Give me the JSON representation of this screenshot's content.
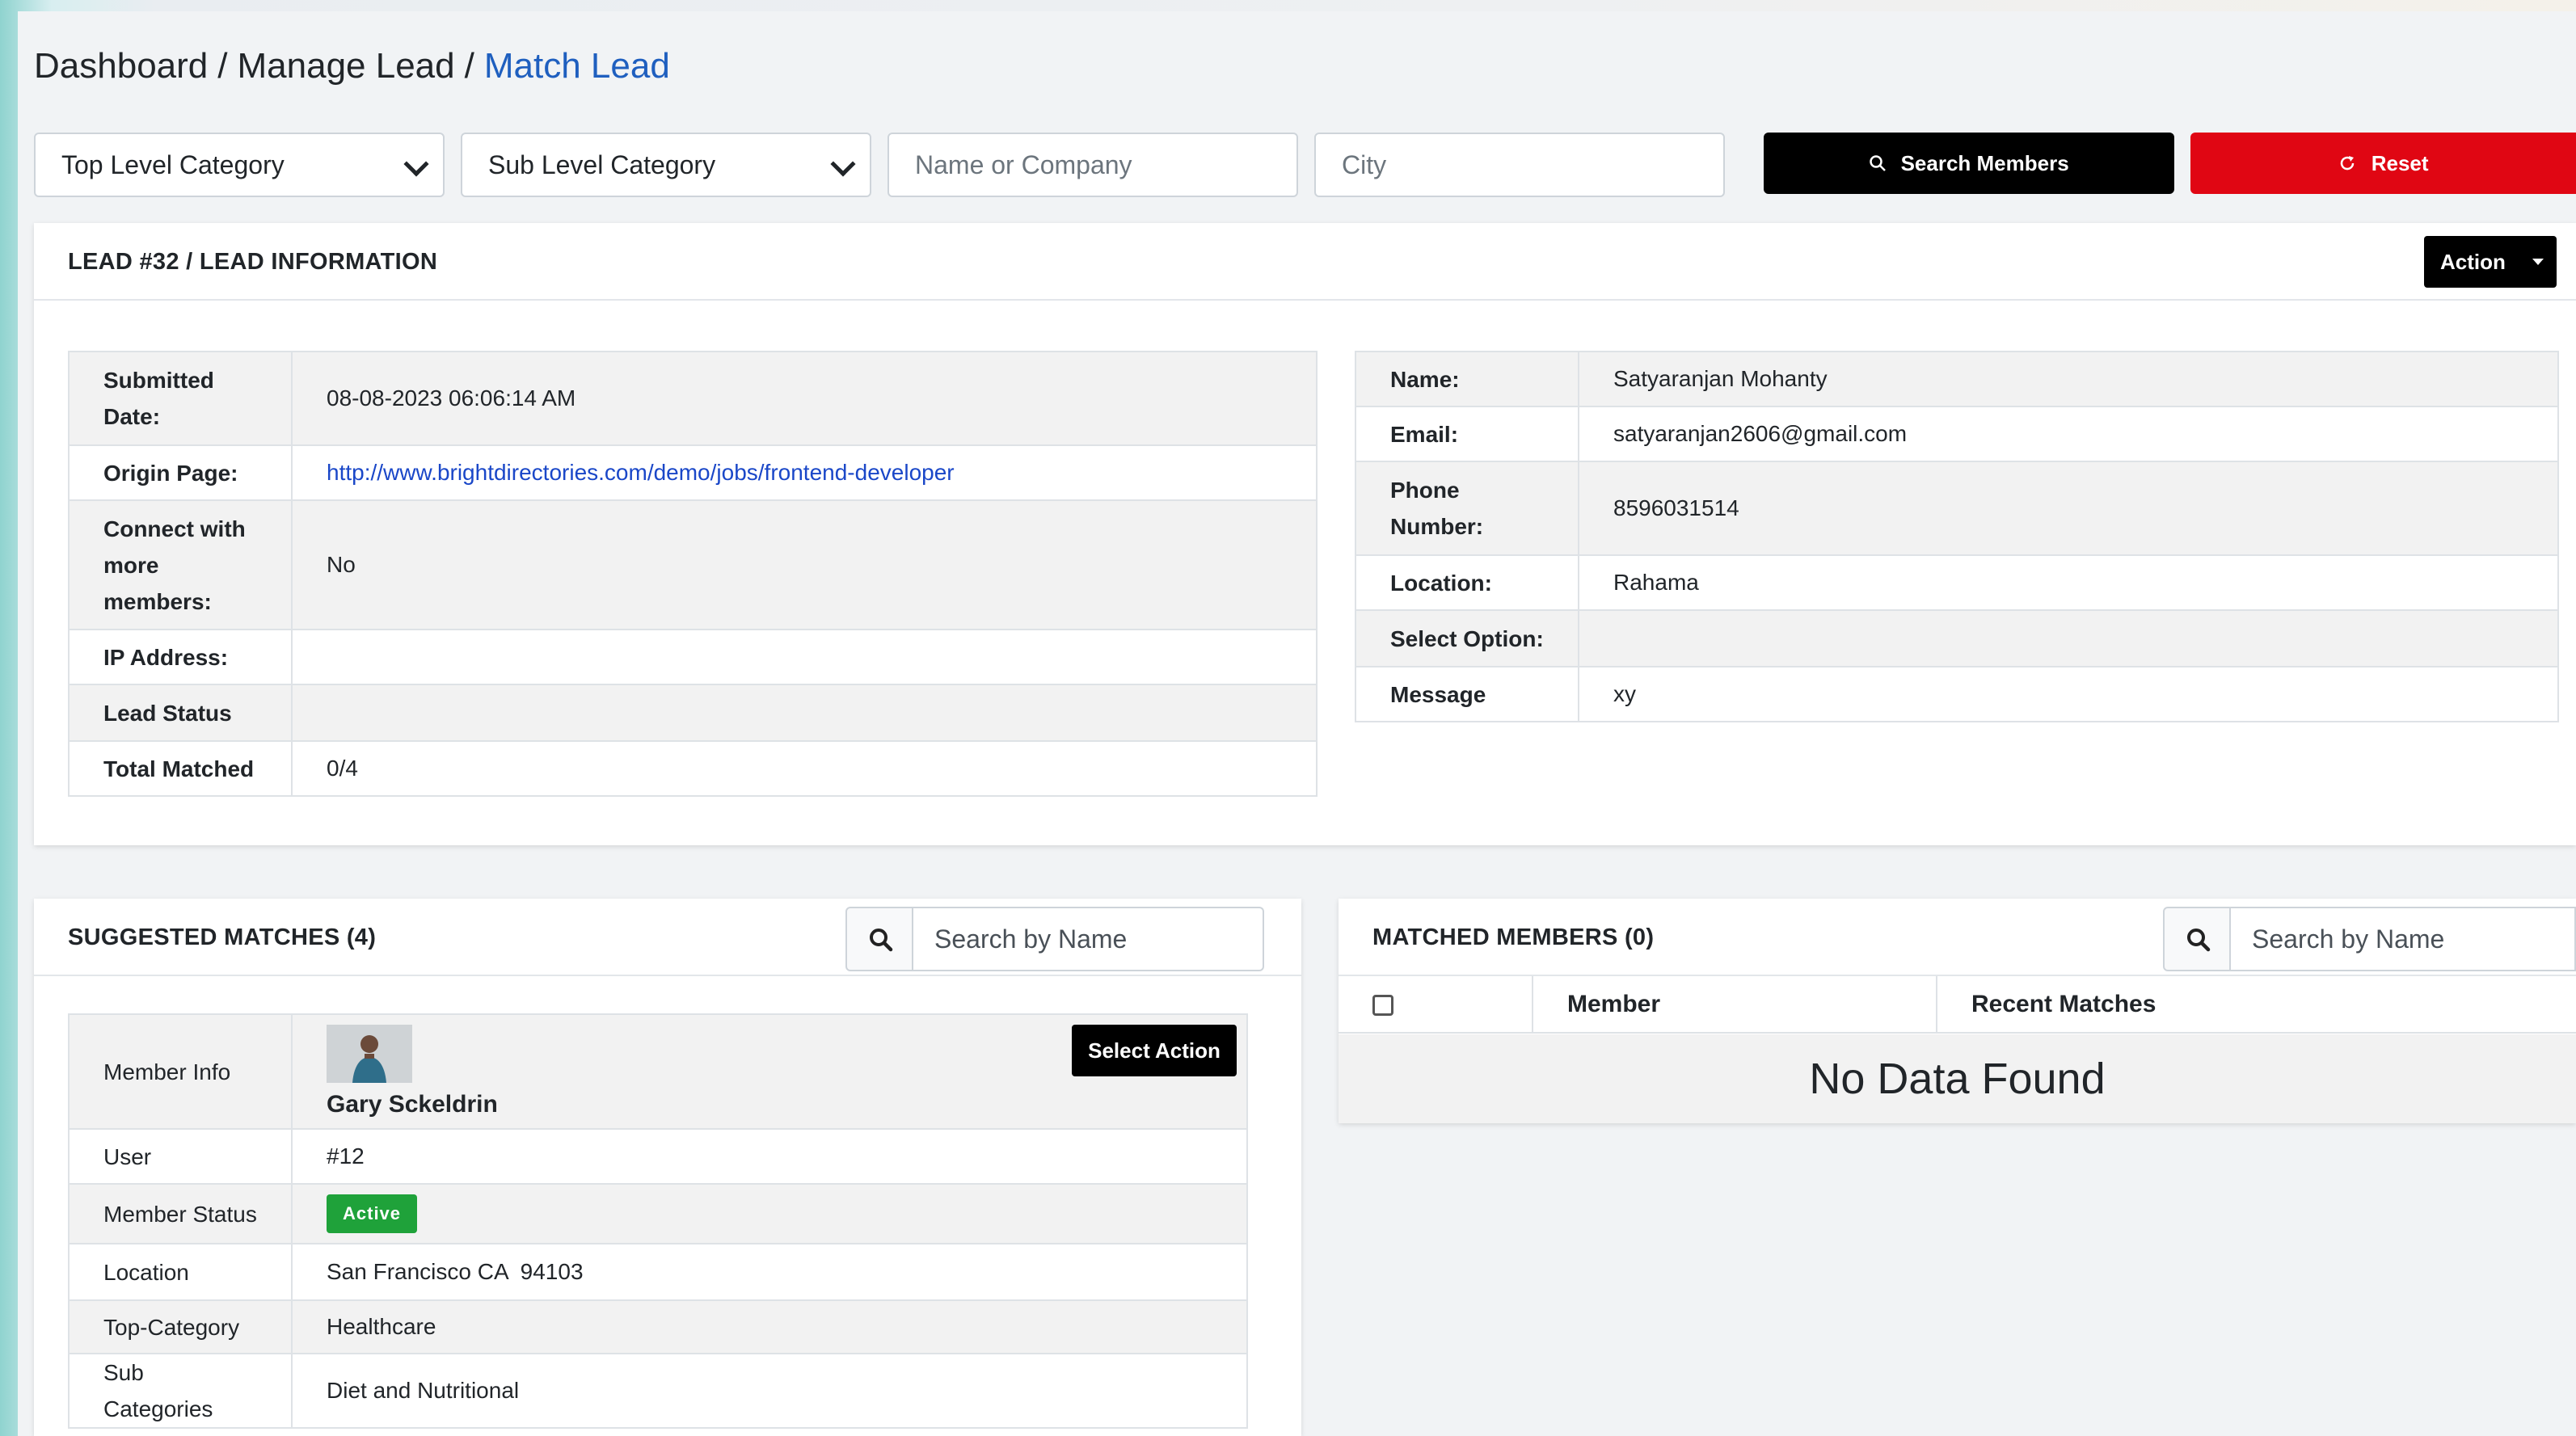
{
  "breadcrumb": {
    "dashboard": "Dashboard",
    "manage_lead": "Manage Lead",
    "current": "Match Lead",
    "separator": "/"
  },
  "filters": {
    "top_level": "Top Level Category",
    "sub_level": "Sub Level Category",
    "name_placeholder": "Name or Company",
    "city_placeholder": "City",
    "search_label": "Search Members",
    "reset_label": "Reset"
  },
  "lead": {
    "title": "LEAD #32 / LEAD INFORMATION",
    "action_label": "Action",
    "left": [
      {
        "label": "Submitted Date:",
        "value": "08-08-2023 06:06:14 AM"
      },
      {
        "label": "Origin Page:",
        "value": "http://www.brightdirectories.com/demo/jobs/frontend-developer"
      },
      {
        "label": "Connect with more members:",
        "value": "No"
      },
      {
        "label": "IP Address:",
        "value": ""
      },
      {
        "label": "Lead Status",
        "value": ""
      },
      {
        "label": "Total Matched",
        "value": "0/4"
      }
    ],
    "right": [
      {
        "label": "Name:",
        "value": "Satyaranjan Mohanty"
      },
      {
        "label": "Email:",
        "value": "satyaranjan2606@gmail.com"
      },
      {
        "label": "Phone Number:",
        "value": "8596031514"
      },
      {
        "label": "Location:",
        "value": "Rahama"
      },
      {
        "label": "Select Option:",
        "value": ""
      },
      {
        "label": "Message",
        "value": "xy"
      }
    ]
  },
  "suggested": {
    "title": "SUGGESTED MATCHES (4)",
    "search_placeholder": "Search by Name",
    "member_info_label": "Member Info",
    "member_name": "Gary Sckeldrin",
    "select_action": "Select Action",
    "rows": [
      {
        "label": "User",
        "value": "#12"
      },
      {
        "label": "Member Status",
        "value": "Active"
      },
      {
        "label": "Location",
        "value": "San Francisco CA  94103"
      },
      {
        "label": "Top-Category",
        "value": "Healthcare"
      },
      {
        "label": "Sub Categories",
        "value": "Diet and Nutritional"
      }
    ]
  },
  "matched": {
    "title": "MATCHED MEMBERS (0)",
    "search_placeholder": "Search by Name",
    "col_member": "Member",
    "col_recent": "Recent Matches",
    "empty": "No Data Found"
  },
  "colors": {
    "breadcrumb_link": "#1f5fbf",
    "reset": "#e00613",
    "active_badge": "#1fa23a"
  }
}
